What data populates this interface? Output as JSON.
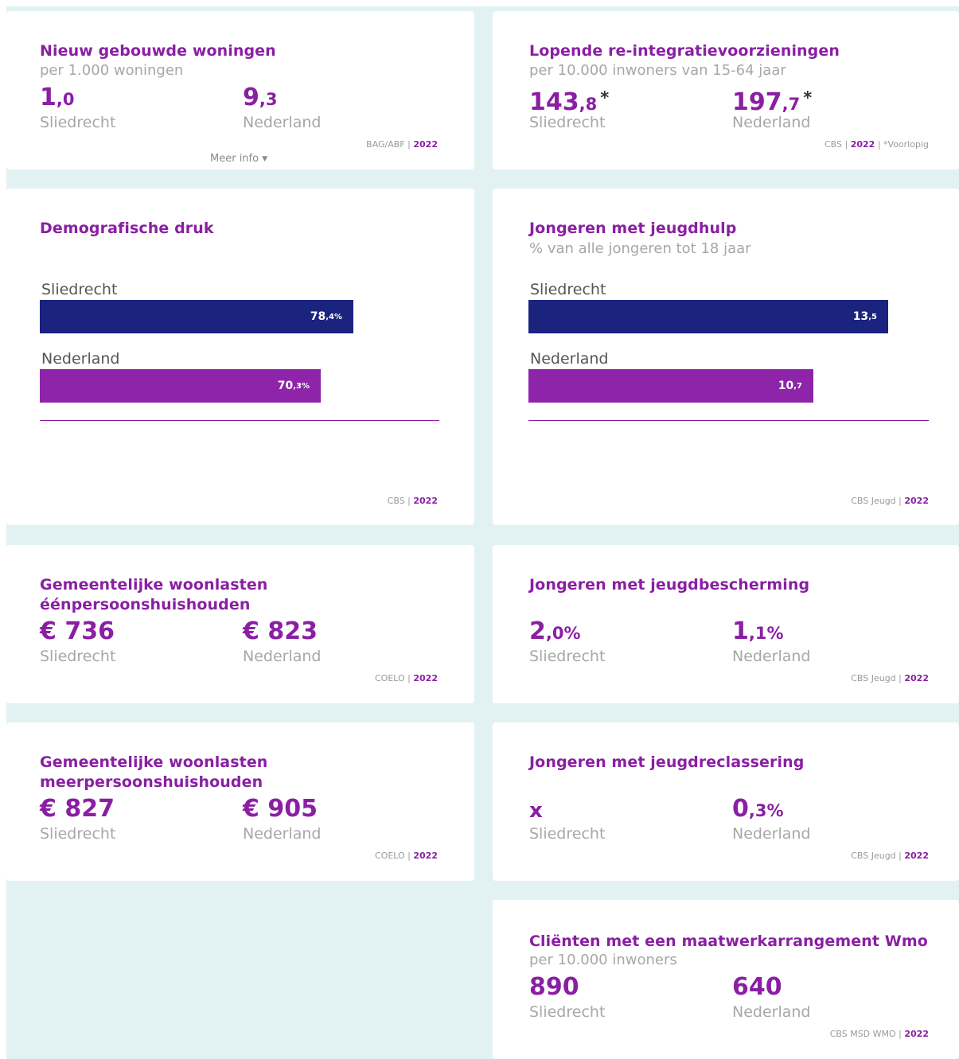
{
  "cards": {
    "nieuwbouw": {
      "title": "Nieuw gebouwde woningen",
      "subtitle": "per 1.000 woningen",
      "local": {
        "int": "1",
        "dec": ",0",
        "label": "Sliedrecht"
      },
      "national": {
        "int": "9",
        "dec": ",3",
        "label": "Nederland"
      },
      "source": "BAG/ABF |",
      "year": "2022",
      "more": "Meer info",
      "more_icon": "▼"
    },
    "reintegratie": {
      "title": "Lopende re-integratievoorzieningen",
      "subtitle": "per 10.000 inwoners van 15-64 jaar",
      "local": {
        "int": "143",
        "dec": ",8",
        "star": "*",
        "label": "Sliedrecht"
      },
      "national": {
        "int": "197",
        "dec": ",7",
        "star": "*",
        "label": "Nederland"
      },
      "source": "CBS |",
      "year": "2022",
      "note": "| *Voorlopig"
    },
    "demografisch": {
      "title": "Demografische druk",
      "local": {
        "label": "Sliedrecht",
        "int": "78",
        "dec": ",4%",
        "value": 78.4
      },
      "national": {
        "label": "Nederland",
        "int": "70",
        "dec": ",3%",
        "value": 70.3
      },
      "source": "CBS |",
      "year": "2022"
    },
    "jeugdhulp": {
      "title": "Jongeren met jeugdhulp",
      "subtitle": "% van alle jongeren tot 18 jaar",
      "local": {
        "label": "Sliedrecht",
        "int": "13",
        "dec": ",5",
        "value": 13.5
      },
      "national": {
        "label": "Nederland",
        "int": "10",
        "dec": ",7",
        "value": 10.7
      },
      "source": "CBS Jeugd |",
      "year": "2022"
    },
    "woonlasten_een": {
      "title_line1": "Gemeentelijke woonlasten",
      "title_line2": "éénpersoonshuishouden",
      "local": {
        "value": "€ 736",
        "label": "Sliedrecht"
      },
      "national": {
        "value": "€ 823",
        "label": "Nederland"
      },
      "source": "COELO |",
      "year": "2022"
    },
    "jeugdbescherming": {
      "title": "Jongeren met jeugdbescherming",
      "local": {
        "int": "2",
        "dec": ",0%",
        "label": "Sliedrecht"
      },
      "national": {
        "int": "1",
        "dec": ",1%",
        "label": "Nederland"
      },
      "source": "CBS Jeugd |",
      "year": "2022"
    },
    "woonlasten_meer": {
      "title_line1": "Gemeentelijke woonlasten",
      "title_line2": "meerpersoonshuishouden",
      "local": {
        "value": "€ 827",
        "label": "Sliedrecht"
      },
      "national": {
        "value": "€ 905",
        "label": "Nederland"
      },
      "source": "COELO |",
      "year": "2022"
    },
    "jeugdreclassering": {
      "title": "Jongeren met jeugdreclassering",
      "local": {
        "value": "x",
        "label": "Sliedrecht"
      },
      "national": {
        "int": "0",
        "dec": ",3%",
        "label": "Nederland"
      },
      "source": "CBS Jeugd |",
      "year": "2022"
    },
    "wmo": {
      "title": "Cliënten met een maatwerkarrangement Wmo",
      "subtitle": "per 10.000 inwoners",
      "local": {
        "value": "890",
        "label": "Sliedrecht"
      },
      "national": {
        "value": "640",
        "label": "Nederland"
      },
      "source": "CBS MSD WMO |",
      "year": "2022"
    }
  },
  "chart_data": [
    {
      "type": "bar",
      "title": "Demografische druk",
      "categories": [
        "Sliedrecht",
        "Nederland"
      ],
      "values": [
        78.4,
        70.3
      ],
      "xlim": [
        0,
        100
      ]
    },
    {
      "type": "bar",
      "title": "Jongeren met jeugdhulp",
      "categories": [
        "Sliedrecht",
        "Nederland"
      ],
      "values": [
        13.5,
        10.7
      ],
      "xlim": [
        0,
        15
      ]
    }
  ],
  "colors": {
    "accent": "#8a1fa3",
    "navy_bar": "#1a237e",
    "purple_bar": "#8e24aa",
    "background": "#e2f2f2"
  }
}
